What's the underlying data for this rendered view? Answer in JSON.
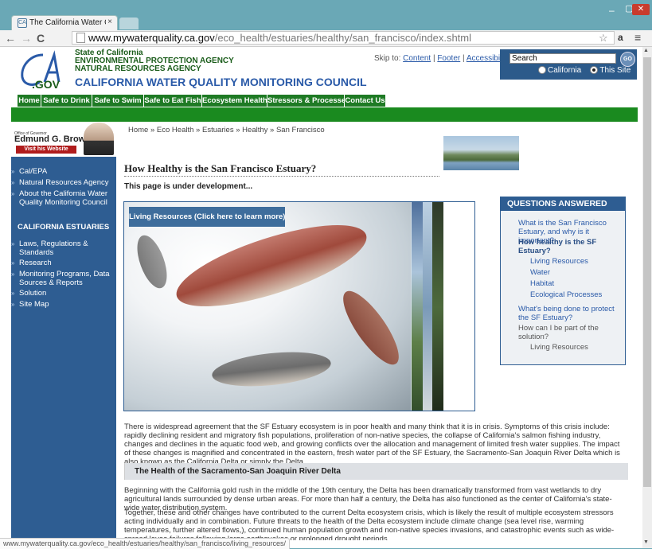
{
  "browser": {
    "tab_title": "The California Water Qual",
    "tab_close": "×",
    "url_domain": "www.mywaterquality.ca.gov",
    "url_path": "/eco_health/estuaries/healthy/san_francisco/index.shtml",
    "status_url": "www.mywaterquality.ca.gov/eco_health/estuaries/healthy/san_francisco/living_resources/",
    "icons": [
      "back-icon",
      "forward-icon",
      "reload-icon",
      "page-icon",
      "star-icon",
      "amazon-icon",
      "menu-icon",
      "minimize-icon",
      "maximize-icon",
      "close-icon"
    ]
  },
  "header": {
    "logo_text": "CA",
    "logo_sub": ".GOV",
    "agency_lines": [
      "State of California",
      "ENVIRONMENTAL PROTECTION AGENCY",
      "NATURAL RESOURCES AGENCY"
    ],
    "council": "CALIFORNIA WATER QUALITY MONITORING COUNCIL",
    "skip_label": "Skip to:",
    "skip_links": [
      "Content",
      "Footer",
      "Accessibility"
    ],
    "search_placeholder": "Search",
    "search_go": "GO",
    "scope_options": [
      "California",
      "This Site"
    ],
    "scope_selected": "This Site"
  },
  "topnav": [
    "Home",
    "Safe to Drink",
    "Safe to Swim",
    "Safe to Eat Fish",
    "Ecosystem Health",
    "Stressors & Processes",
    "Contact Us"
  ],
  "sidebar": {
    "governor_office": "Office of Governor",
    "governor_name": "Edmund G. Brown Jr.",
    "governor_button": "Visit his Website",
    "links": [
      "Cal/EPA",
      "Natural Resources Agency",
      "About the California Water Quality Monitoring Council"
    ],
    "heading": "CALIFORNIA ESTUARIES",
    "estuary_links": [
      "Laws, Regulations & Standards",
      "Research",
      "Monitoring Programs, Data Sources & Reports",
      "Solution",
      "Site Map"
    ]
  },
  "main": {
    "breadcrumb": [
      "Home",
      "Eco Health",
      "Estuaries",
      "Healthy",
      "San Francisco"
    ],
    "breadcrumb_sep": "»",
    "title": "How Healthy is the San Francisco Estuary?",
    "notice": "This page is under development...",
    "hero_label": "Living Resources (Click here to learn more)",
    "intro": "There is widespread agreement that the SF Estuary ecosystem is in poor health and many think that it is in crisis. Symptoms of this crisis include: rapidly declining resident and migratory fish populations, proliferation of non-native species, the collapse of California's salmon fishing industry, changes and declines in the aquatic food web, and growing conflicts over the allocation and management of limited fresh water supplies. The impact of these changes is magnified and concentrated in the eastern, fresh water part of the SF Estuary, the Sacramento-San Joaquin River Delta which is also known as the California Delta or simply the Delta.",
    "section_title": "The Health of the Sacramento-San Joaquin River Delta",
    "para2": "Beginning with the California gold rush in the middle of the 19th century, the Delta has been dramatically transformed from vast wetlands to dry agricultural lands surrounded by dense urban areas. For more than half a century, the Delta has also functioned as the center of California's state-wide water distribution system.",
    "para3": "Together, these and other changes have contributed to the current Delta ecosystem crisis, which is likely the result of multiple ecosystem stressors acting individually and in combination. Future threats to the health of the Delta ecosystem include climate change (sea level rise, warming temperatures, further altered flows,), continued human population growth and non-native species invasions, and catastrophic events such as wide-spread levee failures following large earthquakes or prolonged drought periods."
  },
  "questions": {
    "heading": "QUESTIONS ANSWERED",
    "q1": "What is the San Francisco Estuary, and why is it important?",
    "q2": "How healthy is the SF Estuary?",
    "q2_subs": [
      "Living Resources",
      "Water",
      "Habitat",
      "Ecological Processes"
    ],
    "q3": "What's being done to protect the SF Estuary?",
    "q4": "How can I be part of the solution?",
    "q4_subs": [
      "Living Resources"
    ]
  },
  "colors": {
    "nav_green": "#1e7a24",
    "sidebar_blue": "#2e5d92",
    "link_blue": "#2a5aa8",
    "chrome_teal": "#6aa8b6"
  }
}
